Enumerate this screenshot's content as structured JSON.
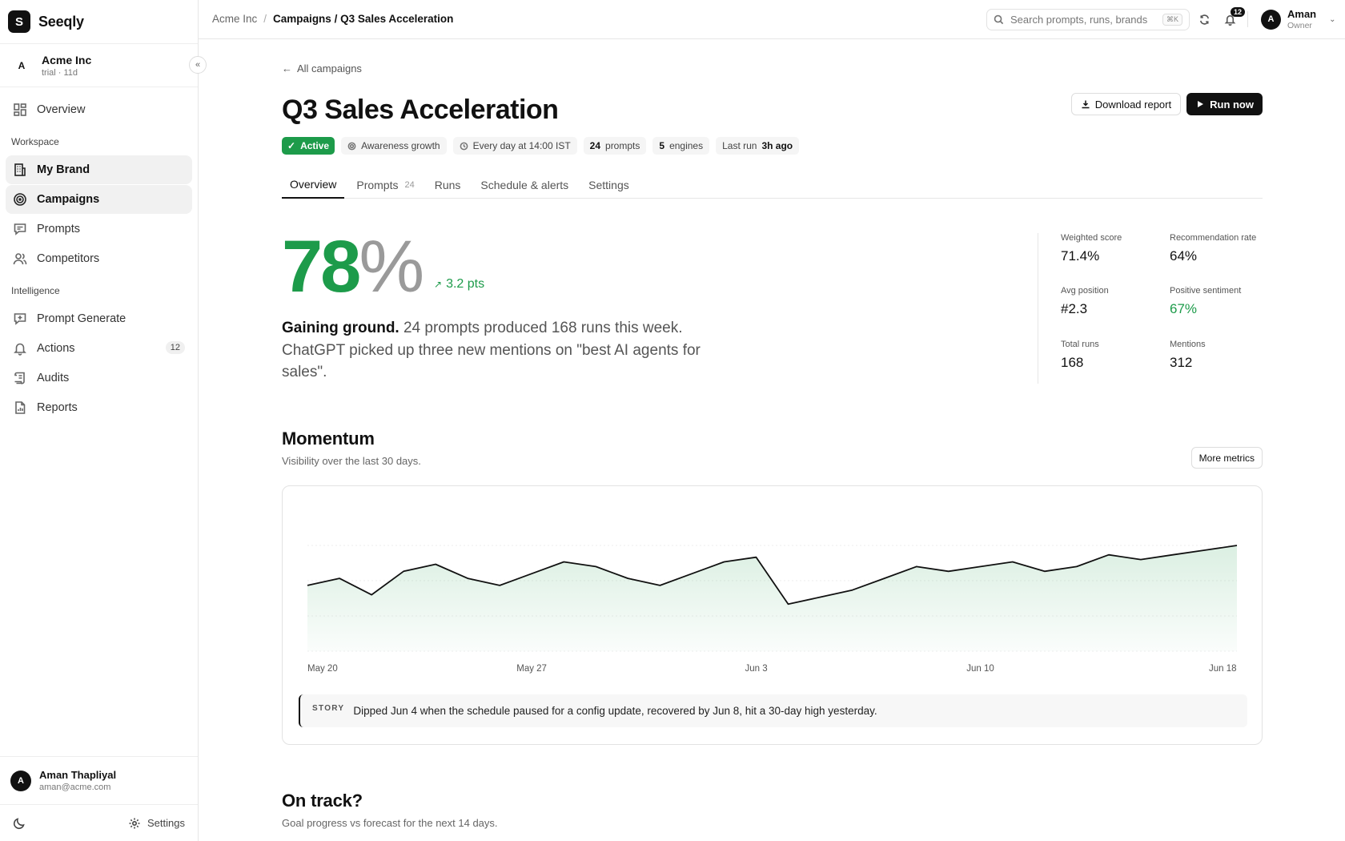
{
  "app": {
    "logo_letter": "S",
    "name": "Seeqly"
  },
  "org": {
    "avatar": "A",
    "name": "Acme Inc",
    "sub": "trial · 11d"
  },
  "sidebar": {
    "collapse_label": "«",
    "overview": "Overview",
    "workspace_label": "Workspace",
    "workspace": [
      {
        "label": "My Brand",
        "icon": "building-icon"
      },
      {
        "label": "Campaigns",
        "icon": "target-icon"
      },
      {
        "label": "Prompts",
        "icon": "message-icon"
      },
      {
        "label": "Competitors",
        "icon": "users-icon"
      }
    ],
    "intelligence_label": "Intelligence",
    "intelligence": [
      {
        "label": "Prompt Generate",
        "icon": "message-plus-icon"
      },
      {
        "label": "Actions",
        "icon": "bell-icon",
        "badge": "12"
      },
      {
        "label": "Audits",
        "icon": "scroll-icon"
      },
      {
        "label": "Reports",
        "icon": "file-chart-icon"
      }
    ],
    "user": {
      "avatar": "A",
      "name": "Aman Thapliyal",
      "email": "aman@acme.com"
    },
    "settings_label": "Settings"
  },
  "topbar": {
    "crumb_root": "Acme Inc",
    "crumb_sep": "/",
    "crumb_current": "Campaigns / Q3 Sales Acceleration",
    "search_placeholder": "Search prompts, runs, brands",
    "search_kbd": "⌘K",
    "notifications": "12",
    "account": {
      "avatar": "A",
      "name": "Aman",
      "role": "Owner"
    }
  },
  "page": {
    "back_label": "All campaigns",
    "title": "Q3 Sales Acceleration",
    "download_label": "Download report",
    "run_label": "Run now",
    "chips": {
      "status": "Active",
      "goal": "Awareness growth",
      "schedule": "Every day at 14:00 IST",
      "prompts_num": "24",
      "prompts_word": "prompts",
      "engines_num": "5",
      "engines_word": "engines",
      "last_run_label": "Last run",
      "last_run_value": "3h ago"
    },
    "tabs": [
      {
        "label": "Overview"
      },
      {
        "label": "Prompts",
        "count": "24"
      },
      {
        "label": "Runs"
      },
      {
        "label": "Schedule & alerts"
      },
      {
        "label": "Settings"
      }
    ],
    "score": {
      "value": "78",
      "unit": "%",
      "delta": "3.2 pts"
    },
    "summary": {
      "lead": "Gaining ground.",
      "text": " 24 prompts produced 168 runs this week. ChatGPT picked up three new mentions on \"best AI agents for sales\"."
    },
    "stats": [
      {
        "label": "Weighted score",
        "value": "71.4%"
      },
      {
        "label": "Recommendation rate",
        "value": "64%"
      },
      {
        "label": "Avg position",
        "value": "#2.3"
      },
      {
        "label": "Positive sentiment",
        "value": "67%"
      },
      {
        "label": "Total runs",
        "value": "168"
      },
      {
        "label": "Mentions",
        "value": "312"
      }
    ],
    "momentum": {
      "title": "Momentum",
      "subtitle": "Visibility over the last 30 days.",
      "more_label": "More metrics",
      "story_tag": "STORY",
      "story_text": "Dipped Jun 4 when the schedule paused for a config update, recovered by Jun 8, hit a 30-day high yesterday."
    },
    "on_track": {
      "title": "On track?",
      "subtitle": "Goal progress vs forecast for the next 14 days."
    }
  },
  "colors": {
    "accent_green": "#1d9b4a",
    "dark": "#111111"
  },
  "chart_data": {
    "type": "area",
    "x": [
      "May 20",
      "May 21",
      "May 22",
      "May 23",
      "May 24",
      "May 25",
      "May 26",
      "May 27",
      "May 28",
      "May 29",
      "May 30",
      "May 31",
      "Jun 1",
      "Jun 2",
      "Jun 3",
      "Jun 4",
      "Jun 5",
      "Jun 6",
      "Jun 7",
      "Jun 8",
      "Jun 9",
      "Jun 10",
      "Jun 11",
      "Jun 12",
      "Jun 13",
      "Jun 14",
      "Jun 15",
      "Jun 16",
      "Jun 17",
      "Jun 18"
    ],
    "tick_labels": [
      "May 20",
      "May 27",
      "Jun 3",
      "Jun 10",
      "Jun 18"
    ],
    "series": [
      {
        "values": [
          58,
          61,
          54,
          64,
          67,
          61,
          58,
          63,
          68,
          66,
          61,
          58,
          63,
          68,
          70,
          50,
          53,
          56,
          61,
          66,
          64,
          66,
          68,
          64,
          66,
          71,
          69,
          71,
          73,
          75
        ]
      }
    ],
    "ylim": [
      30,
      90
    ],
    "grid": true
  }
}
